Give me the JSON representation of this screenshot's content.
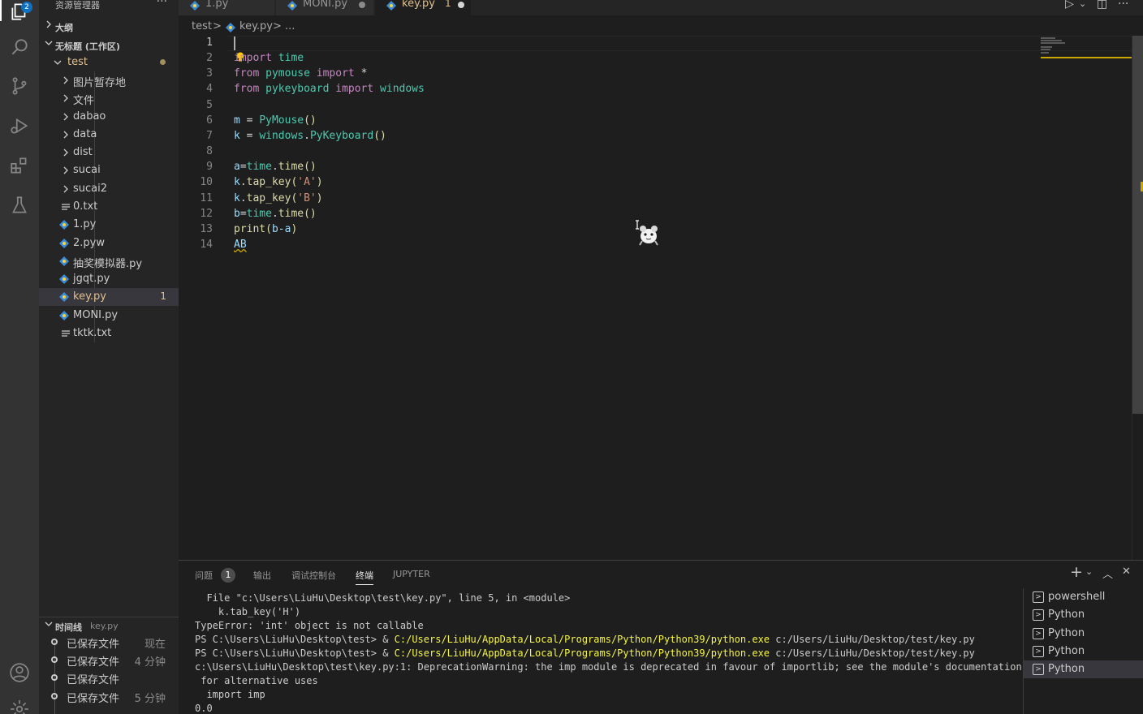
{
  "activity": {
    "explorer_badge": "2"
  },
  "sidebar": {
    "header": "资源管理器",
    "header_more": "···",
    "outline": "大纲",
    "workspace": "无标题 (工作区)",
    "root_folder": "test",
    "items": [
      {
        "label": "图片暂存地",
        "kind": "folder"
      },
      {
        "label": "文件",
        "kind": "folder"
      },
      {
        "label": "dabao",
        "kind": "folder"
      },
      {
        "label": "data",
        "kind": "folder"
      },
      {
        "label": "dist",
        "kind": "folder"
      },
      {
        "label": "sucai",
        "kind": "folder"
      },
      {
        "label": "sucai2",
        "kind": "folder"
      },
      {
        "label": "0.txt",
        "kind": "text"
      },
      {
        "label": "1.py",
        "kind": "python"
      },
      {
        "label": "2.pyw",
        "kind": "python"
      },
      {
        "label": "抽奖模拟器.py",
        "kind": "python"
      },
      {
        "label": "jgqt.py",
        "kind": "python"
      },
      {
        "label": "key.py",
        "kind": "python",
        "problems": "1"
      },
      {
        "label": "MONI.py",
        "kind": "python"
      },
      {
        "label": "tktk.txt",
        "kind": "text"
      }
    ],
    "timeline": {
      "title": "时间线",
      "file": "key.py",
      "entries": [
        {
          "label": "已保存文件",
          "time": "现在"
        },
        {
          "label": "已保存文件",
          "time": "4 分钟"
        },
        {
          "label": "已保存文件",
          "time": ""
        },
        {
          "label": "已保存文件",
          "time": "5 分钟"
        }
      ]
    }
  },
  "tabs": [
    {
      "label": "1.py"
    },
    {
      "label": "MONI.py"
    },
    {
      "label": "key.py",
      "problems": "1"
    }
  ],
  "tab_actions": {
    "run": "▷",
    "run_menu": "⌄",
    "split": "◫",
    "more": "···"
  },
  "breadcrumb": {
    "folder": "test",
    "sep": ">",
    "file": "key.py",
    "tail": "> ..."
  },
  "editor": {
    "line_numbers": [
      "1",
      "2",
      "3",
      "4",
      "5",
      "6",
      "7",
      "8",
      "9",
      "10",
      "11",
      "12",
      "13",
      "14"
    ],
    "lines": {
      "l2": {
        "kw": "import",
        "mod": "time"
      },
      "l3": {
        "kw1": "from",
        "mod": "pymouse",
        "kw2": "import",
        "rest": "*"
      },
      "l4": {
        "kw1": "from",
        "mod": "pykeyboard",
        "kw2": "import",
        "rest": "windows"
      },
      "l6": {
        "var": "m",
        "op": "=",
        "fn": "PyMouse",
        "paren": "()"
      },
      "l7": {
        "var": "k",
        "op": "=",
        "mod": "windows",
        "dot": ".",
        "fn": "PyKeyboard",
        "paren": "()"
      },
      "l9": {
        "var": "a",
        "op": "=",
        "mod": "time",
        "dot": ".",
        "fn": "time",
        "paren": "()"
      },
      "l10": {
        "var": "k",
        "dot": ".",
        "fn": "tap_key",
        "open": "(",
        "str": "'A'",
        "close": ")"
      },
      "l11": {
        "var": "k",
        "dot": ".",
        "fn": "tap_key",
        "open": "(",
        "str": "'B'",
        "close": ")"
      },
      "l12": {
        "var": "b",
        "op": "=",
        "mod": "time",
        "dot": ".",
        "fn": "time",
        "paren": "()"
      },
      "l13": {
        "fn": "print",
        "open": "(",
        "args": "b-a",
        "close": ")"
      },
      "l14": {
        "text": "AB"
      }
    }
  },
  "panel": {
    "tabs": {
      "problems": "问题",
      "problems_count": "1",
      "output": "输出",
      "debug": "调试控制台",
      "terminal": "终端",
      "jupyter": "JUPYTER"
    },
    "actions": {
      "add": "+",
      "add_menu": "⌄",
      "maximize": "︿",
      "close": "✕"
    },
    "terminal_lines": {
      "t1": "  File \"c:\\Users\\LiuHu\\Desktop\\test\\key.py\", line 5, in <module>",
      "t2": "    k.tab_key('H')",
      "t3": "TypeError: 'int' object is not callable",
      "t4a": "PS C:\\Users\\LiuHu\\Desktop\\test> & ",
      "t4b": "C:/Users/LiuHu/AppData/Local/Programs/Python/Python39/python.exe",
      "t4c": " c:/Users/LiuHu/Desktop/test/key.py",
      "t5a": "PS C:\\Users\\LiuHu\\Desktop\\test> & ",
      "t5b": "C:/Users/LiuHu/AppData/Local/Programs/Python/Python39/python.exe",
      "t5c": " c:/Users/LiuHu/Desktop/test/key.py",
      "t6": "c:\\Users\\LiuHu\\Desktop\\test\\key.py:1: DeprecationWarning: the imp module is deprecated in favour of importlib; see the module's documentation",
      "t7": " for alternative uses",
      "t8": "  import imp",
      "t9": "0.0"
    },
    "terminal_list": [
      "powershell",
      "Python",
      "Python",
      "Python",
      "Python"
    ]
  },
  "colors": {
    "accent": "#0e70c0",
    "modified": "#e2c08d",
    "warning": "#cca700"
  }
}
